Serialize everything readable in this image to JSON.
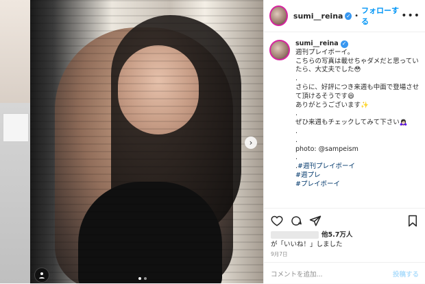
{
  "header": {
    "username": "sumi__reina",
    "follow_label": "フォローする",
    "separator": "•",
    "more_icon": "more-horizontal-icon"
  },
  "caption": {
    "username": "sumi__reina",
    "text": "週刊プレイボーイ。\nこちらの写真は載せちゃダメだと思っていたら、大丈夫でした😳\n.\nさらに、好評につき来週も中面で登場させて頂けるそうです😆\nありがとうございます✨\n.\nぜひ来週もチェックしてみて下さい🙇🏻‍♀️\n.\n.\nphoto: @sampeism\n.\n.",
    "hashtags": [
      "#週刊プレイボーイ",
      "#週プレ",
      "#プレイボーイ"
    ]
  },
  "actions": {
    "like_icon": "heart-icon",
    "comment_icon": "comment-icon",
    "share_icon": "share-icon",
    "save_icon": "bookmark-icon"
  },
  "likes": {
    "suffix": "他5.7万人",
    "line2": "が「いいね！」しました"
  },
  "post_date": "9月7日",
  "comment_box": {
    "placeholder": "コメントを追加...",
    "post_label": "投稿する"
  },
  "carousel": {
    "next_icon": "chevron-right-icon",
    "dots": 2,
    "active_dot": 0
  },
  "colors": {
    "accent_blue": "#0095f6",
    "verified_blue": "#3897f0",
    "story_ring": "#d6249f",
    "hashtag": "#00376b"
  }
}
